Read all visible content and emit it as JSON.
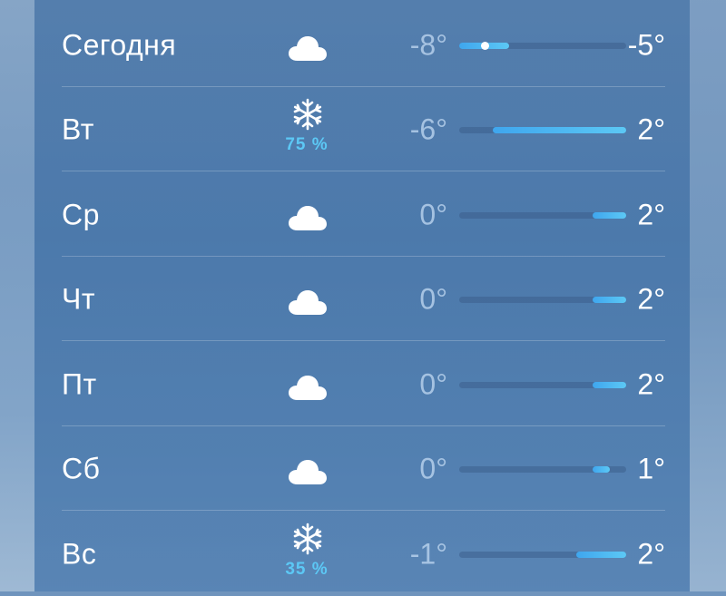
{
  "forecast": {
    "rows": [
      {
        "day": "Сегодня",
        "icon": "cloud-icon",
        "precip": "",
        "low": "-8°",
        "high": "-5°",
        "low_value": -8,
        "high_value": -5,
        "current_value": -6.5
      },
      {
        "day": "Вт",
        "icon": "snowflake-icon",
        "precip": "75 %",
        "low": "-6°",
        "high": "2°",
        "low_value": -6,
        "high_value": 2
      },
      {
        "day": "Ср",
        "icon": "cloud-icon",
        "precip": "",
        "low": "0°",
        "high": "2°",
        "low_value": 0,
        "high_value": 2
      },
      {
        "day": "Чт",
        "icon": "cloud-icon",
        "precip": "",
        "low": "0°",
        "high": "2°",
        "low_value": 0,
        "high_value": 2
      },
      {
        "day": "Пт",
        "icon": "cloud-icon",
        "precip": "",
        "low": "0°",
        "high": "2°",
        "low_value": 0,
        "high_value": 2
      },
      {
        "day": "Сб",
        "icon": "cloud-icon",
        "precip": "",
        "low": "0°",
        "high": "1°",
        "low_value": 0,
        "high_value": 1
      },
      {
        "day": "Вс",
        "icon": "snowflake-icon",
        "precip": "35 %",
        "low": "-1°",
        "high": "2°",
        "low_value": -1,
        "high_value": 2
      }
    ],
    "range_min": -8,
    "range_max": 2,
    "colors": {
      "bar": "#5cc8f5",
      "bar_cold": "#3fa6ee",
      "precip": "#5cc8f5",
      "current_dot": "#ffffff"
    }
  }
}
